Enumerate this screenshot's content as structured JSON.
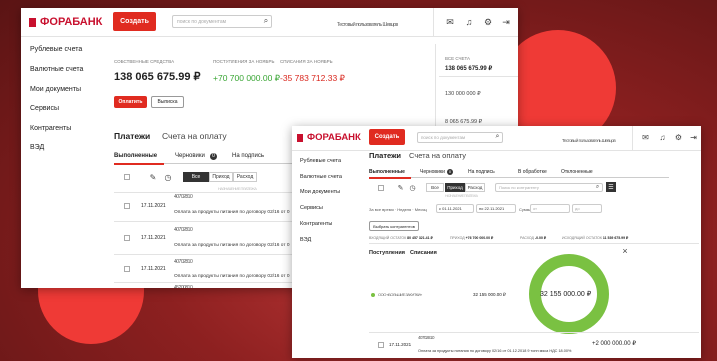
{
  "bank_name": "ФОРАБАНК",
  "colors": {
    "brand_red": "#e02b20",
    "income_green": "#3aa635",
    "expense_red": "#d9271e",
    "accent_green": "#7ac142"
  },
  "w1": {
    "create_button": "Создать",
    "search_placeholder": "поиск по документам",
    "client_label": "Тестовый пользователь Шевцов",
    "sidebar": [
      "Рублевые счета",
      "Валютные счета",
      "Мои документы",
      "Сервисы",
      "Контрагенты",
      "ВЭД"
    ],
    "balance_label": "СОБСТВЕННЫЕ СРЕДСТВА",
    "balance_value": "138 065 675.99 ₽",
    "income_label": "ПОСТУПЛЕНИЯ ЗА НОЯБРЬ",
    "income_value": "+70 700 000.00 ₽",
    "expense_label": "СПИСАНИЯ ЗА НОЯБРЬ",
    "expense_value": "-35 783 712.33 ₽",
    "pay_button": "Оплатить",
    "statement_button": "Выписка",
    "right_panel": {
      "all_accounts_label": "ВСЕ СЧЕТА",
      "all_accounts_value": "138 065 675.99 ₽",
      "acc1_value": "130 000 000 ₽",
      "acc2_value": "8 065 675.99 ₽"
    },
    "tabs": [
      "Платежи",
      "Счета на оплату"
    ],
    "subtabs": [
      "Выполненные",
      "Черновики",
      "На подпись"
    ],
    "draft_count": "0",
    "filters": [
      "Все",
      "Приход",
      "Расход"
    ],
    "column_header": "НАЗНАЧЕНИЕ ПЛАТЕЖА",
    "rows": [
      {
        "date": "17.11.2021",
        "number": "40702810",
        "purpose": "Оплата за продукты питания по договору 02/16 от 0"
      },
      {
        "date": "17.11.2021",
        "number": "40702810",
        "purpose": "Оплата за продукты питания по договору 02/16 от 0"
      },
      {
        "date": "17.11.2021",
        "number": "40702810",
        "purpose": "Оплата за продукты питания по договору 02/16 от 0"
      },
      {
        "date": "",
        "number": "45200810",
        "purpose": ""
      }
    ]
  },
  "w2": {
    "create_button": "Создать",
    "search_placeholder": "поиск по документам",
    "client_label": "Тестовый пользователь Шевцов",
    "sidebar": [
      "Рублевые счета",
      "Валютные счета",
      "Мои документы",
      "Сервисы",
      "Контрагенты",
      "ВЭД"
    ],
    "tabs": [
      "Платежи",
      "Счета на оплату"
    ],
    "subtabs": [
      "Выполненные",
      "Черновики",
      "На подпись",
      "В обработке",
      "Отклоненные"
    ],
    "draft_count": "0",
    "filters": [
      "Все",
      "Приход",
      "Расход"
    ],
    "filter_search_placeholder": "Поиск по контрагенту",
    "column_header": "НАЗНАЧЕНИЕ ПЛАТЕЖА",
    "period_label": "За все время · Неделя · Месяц",
    "date_from": "с 01.11.2021",
    "date_to": "по 22.11.2021",
    "amount_label": "Сумма",
    "amount_from": "от",
    "amount_to": "до",
    "select_counterparty_button": "Выбрать контрагентов",
    "summary": [
      {
        "label": "ВХОДЯЩИЙ ОСТАТОК",
        "value": "80 457 321.41 ₽"
      },
      {
        "label": "ПРИХОД",
        "value": "+76 700 000.00 ₽"
      },
      {
        "label": "РАСХОД",
        "value": "-0.00 ₽"
      },
      {
        "label": "ИСХОДЯЩИЙ ОСТАТОК",
        "value": "11 539 675.99 ₽"
      }
    ],
    "chart_tabs": [
      "Поступления",
      "Списания"
    ],
    "close_label": "×",
    "legend_label": "ООО «БОЛЬШИЕ ЗАКУПКИ»",
    "legend_value": "32 155 000.00 ₽",
    "ring_total": "32 155 000.00 ₽",
    "row": {
      "date": "17.11.2021",
      "number": "40702810",
      "purpose": "Оплата за продукты питания по договору 02/16 от 01.12.2018 9 тонн мяса НДС 18.00%",
      "amount": "+2 000 000.00 ₽"
    }
  }
}
